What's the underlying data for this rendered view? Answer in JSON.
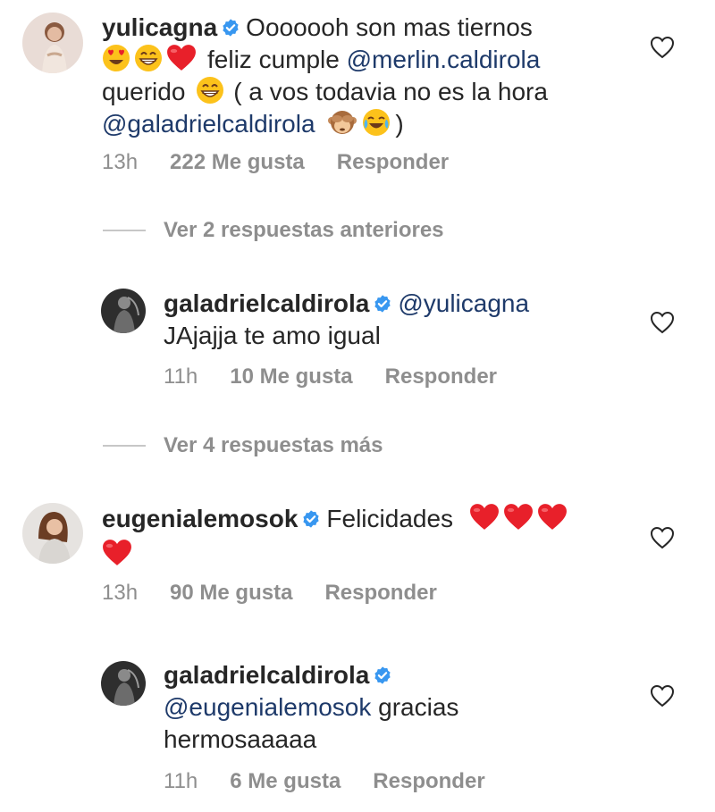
{
  "comments": [
    {
      "username": "yulicagna",
      "parts": {
        "a": "Ooooooh son mas tiernos",
        "b": "feliz cumple",
        "mention1": "@merlin.caldirola",
        "c": "querido",
        "d": "( a vos todavia no es la hora",
        "mention2": "@galadrielcaldirola",
        "e": ")"
      },
      "time": "13h",
      "likes": "222 Me gusta",
      "reply": "Responder"
    },
    {
      "username": "galadrielcaldirola",
      "mention": "@yulicagna",
      "text": "JAjajja te amo igual",
      "time": "11h",
      "likes": "10 Me gusta",
      "reply": "Responder"
    },
    {
      "username": "eugenialemosok",
      "text": "Felicidades",
      "time": "13h",
      "likes": "90 Me gusta",
      "reply": "Responder"
    },
    {
      "username": "galadrielcaldirola",
      "mention": "@eugenialemosok",
      "text1": "gracias",
      "text2": "hermosaaaaa",
      "time": "11h",
      "likes": "6 Me gusta",
      "reply": "Responder"
    }
  ],
  "view_previous": "Ver 2 respuestas anteriores",
  "view_more": "Ver 4 respuestas más",
  "icons": {
    "verified": "verified-badge-icon",
    "like": "heart-outline-icon",
    "accent": "#3897f0",
    "mention_color": "#1e3a6a"
  }
}
